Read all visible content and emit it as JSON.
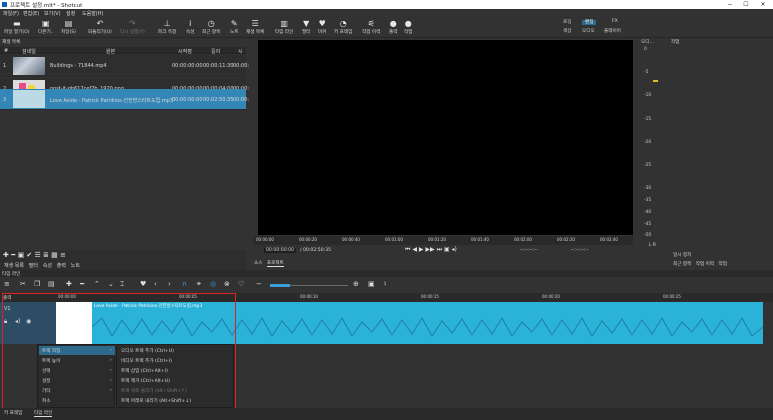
{
  "window": {
    "title": "프로젝트 설정.mlt* - Shotcut",
    "minimize": "−",
    "maximize": "☐",
    "close": "✕"
  },
  "menu": [
    "파일(F)",
    "편집(E)",
    "보기(V)",
    "설정",
    "도움말(H)"
  ],
  "toolbar": [
    {
      "label": "파일 열기(O)",
      "icon": "folder-open-icon",
      "glyph": "▬",
      "enabled": true
    },
    {
      "label": "다른기..",
      "icon": "open-other-icon",
      "glyph": "▣",
      "enabled": true
    },
    {
      "label": "저장(S)",
      "icon": "save-icon",
      "glyph": "▤",
      "enabled": true
    },
    {
      "label": "되돌리기(U)",
      "icon": "undo-icon",
      "glyph": "↶",
      "enabled": true
    },
    {
      "label": "다시 실행(Y)",
      "icon": "redo-icon",
      "glyph": "↷",
      "enabled": false
    },
    {
      "label": "피크 측정",
      "icon": "peak-meter-icon",
      "glyph": "⊥",
      "enabled": true
    },
    {
      "label": "속성",
      "icon": "properties-icon",
      "glyph": "i",
      "enabled": true
    },
    {
      "label": "최근 항목",
      "icon": "recent-icon",
      "glyph": "◷",
      "enabled": true
    },
    {
      "label": "노트",
      "icon": "notes-icon",
      "glyph": "✎",
      "enabled": true
    },
    {
      "label": "재생 목록",
      "icon": "playlist-icon",
      "glyph": "☰",
      "enabled": true
    },
    {
      "label": "타임 라인",
      "icon": "timeline-icon",
      "glyph": "▥",
      "enabled": true
    },
    {
      "label": "필터",
      "icon": "filter-icon",
      "glyph": "▼",
      "enabled": true
    },
    {
      "label": "마커",
      "icon": "marker-icon",
      "glyph": "♥",
      "enabled": true
    },
    {
      "label": "키 프레임",
      "icon": "keyframe-icon",
      "glyph": "◔",
      "enabled": true
    },
    {
      "label": "작업 이력",
      "icon": "history-icon",
      "glyph": "⚟",
      "enabled": true
    },
    {
      "label": "출력",
      "icon": "export-icon",
      "glyph": "●",
      "enabled": true
    },
    {
      "label": "작업",
      "icon": "jobs-icon",
      "glyph": "●",
      "enabled": true
    }
  ],
  "layouts": {
    "row1": [
      "로깅",
      "편집",
      "FX"
    ],
    "row2": [
      "색상",
      "오디오",
      "플레이어"
    ],
    "active": "편집"
  },
  "playlist": {
    "title": "재생 목록",
    "columns": [
      "#",
      "섬네일",
      "원본",
      "시작점",
      "길이",
      "시"
    ],
    "rows": [
      {
        "n": "1",
        "name": "Buildings - 71844.mp4",
        "in": "00:00:00:00",
        "dur": "00:00:11:30",
        "start": "00:00:",
        "thumb": "building"
      },
      {
        "n": "2",
        "name": "post-it-gb617cef7b_1920.png",
        "in": "00:00:00:00",
        "dur": "00:00:04:00",
        "start": "00:00:",
        "thumb": "postit"
      },
      {
        "n": "3",
        "name": "Love Aside - Patrick Patrikios-진한방스타트도립.mp3",
        "in": "00:00:00:00",
        "dur": "00:02:50:35",
        "start": "00:00:",
        "thumb": "audio"
      }
    ],
    "footer_tabs": [
      "재생 목록",
      "필터",
      "속성",
      "출력",
      "노트"
    ]
  },
  "player": {
    "timecode": "00:00:00:00",
    "total": "/ 00:02:50:35",
    "ruler": [
      "00:00:00",
      "00:00:20",
      "00:00:40",
      "00:01:00",
      "00:01:20",
      "00:01:40",
      "00:02:00",
      "00:02:20",
      "00:02:40"
    ],
    "in_point": "--:--:--:--",
    "out_point": "--:--:--:--",
    "tabs": [
      "소스",
      "프로젝트"
    ]
  },
  "audio_meter": {
    "title": "오디...",
    "scale": [
      "0",
      "-5",
      "-10",
      "-15",
      "-20",
      "-25",
      "-30",
      "-35",
      "-40",
      "-45",
      "-50"
    ],
    "lr": "L R"
  },
  "right_panel": {
    "title": "작업",
    "button": "일시 정지",
    "tabs": [
      "최근 항목",
      "작업 이력",
      "작업"
    ]
  },
  "timeline": {
    "title": "타임 라인",
    "tracks_label": "출력",
    "track": "V1",
    "ruler": [
      "00:00:00",
      "00:00:05",
      "00:00:10",
      "00:00:15",
      "00:00:20",
      "00:00:25"
    ],
    "clip_label": "Love Aside - Patrick Patrikios-진한방스타트도립.mp3"
  },
  "context_menu": {
    "items": [
      "트랙 작업",
      "트랙 높이",
      "선택",
      "설정",
      "기타",
      "취소"
    ],
    "submenu": [
      "오디오 트랙 추가 (Ctrl+U)",
      "비디오 트랙 추가 (Ctrl+I)",
      "트랙 삽입 (Ctrl+Alt+I)",
      "트랙 제거 (Ctrl+Alt+U)",
      "트랙 위로 올리기 (Alt+Shift+↑)",
      "트랙 아래로 내리기 (Alt+Shift+↓)"
    ]
  },
  "bottom_tabs": [
    "키 프레임",
    "타임 라인"
  ]
}
